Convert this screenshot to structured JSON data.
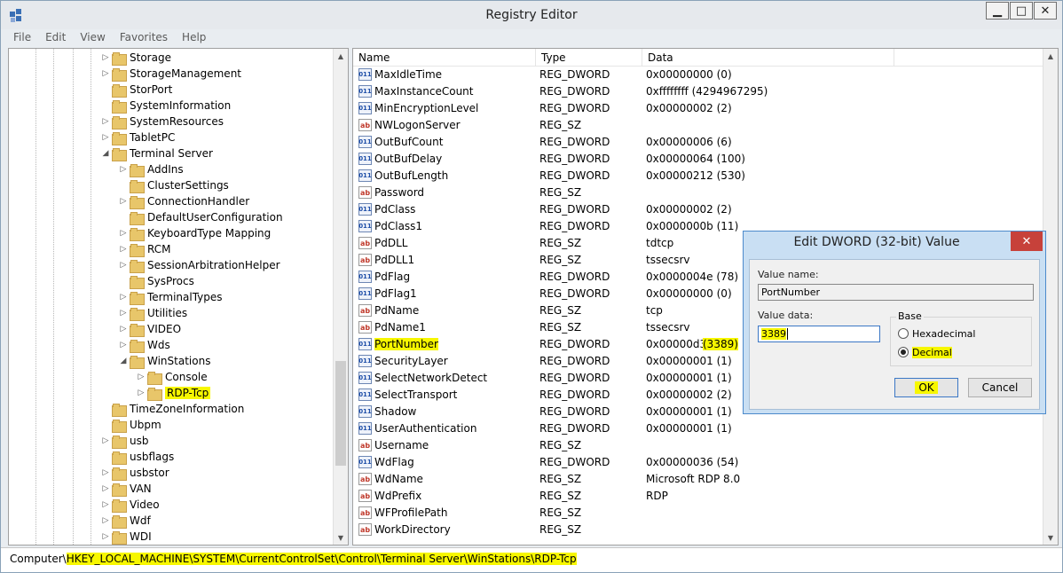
{
  "window": {
    "title": "Registry Editor"
  },
  "menu": [
    "File",
    "Edit",
    "View",
    "Favorites",
    "Help"
  ],
  "tree": [
    {
      "label": "Storage",
      "level": 0,
      "expand": "collapsed"
    },
    {
      "label": "StorageManagement",
      "level": 0,
      "expand": "collapsed"
    },
    {
      "label": "StorPort",
      "level": 0,
      "expand": "none"
    },
    {
      "label": "SystemInformation",
      "level": 0,
      "expand": "none"
    },
    {
      "label": "SystemResources",
      "level": 0,
      "expand": "collapsed"
    },
    {
      "label": "TabletPC",
      "level": 0,
      "expand": "collapsed"
    },
    {
      "label": "Terminal Server",
      "level": 0,
      "expand": "expanded"
    },
    {
      "label": "AddIns",
      "level": 1,
      "expand": "collapsed"
    },
    {
      "label": "ClusterSettings",
      "level": 1,
      "expand": "none"
    },
    {
      "label": "ConnectionHandler",
      "level": 1,
      "expand": "collapsed"
    },
    {
      "label": "DefaultUserConfiguration",
      "level": 1,
      "expand": "none"
    },
    {
      "label": "KeyboardType Mapping",
      "level": 1,
      "expand": "collapsed"
    },
    {
      "label": "RCM",
      "level": 1,
      "expand": "collapsed"
    },
    {
      "label": "SessionArbitrationHelper",
      "level": 1,
      "expand": "collapsed"
    },
    {
      "label": "SysProcs",
      "level": 1,
      "expand": "none"
    },
    {
      "label": "TerminalTypes",
      "level": 1,
      "expand": "collapsed"
    },
    {
      "label": "Utilities",
      "level": 1,
      "expand": "collapsed"
    },
    {
      "label": "VIDEO",
      "level": 1,
      "expand": "collapsed"
    },
    {
      "label": "Wds",
      "level": 1,
      "expand": "collapsed"
    },
    {
      "label": "WinStations",
      "level": 1,
      "expand": "expanded"
    },
    {
      "label": "Console",
      "level": 2,
      "expand": "collapsed"
    },
    {
      "label": "RDP-Tcp",
      "level": 2,
      "expand": "collapsed",
      "selected": true
    },
    {
      "label": "TimeZoneInformation",
      "level": 0,
      "expand": "none"
    },
    {
      "label": "Ubpm",
      "level": 0,
      "expand": "none"
    },
    {
      "label": "usb",
      "level": 0,
      "expand": "collapsed"
    },
    {
      "label": "usbflags",
      "level": 0,
      "expand": "none"
    },
    {
      "label": "usbstor",
      "level": 0,
      "expand": "collapsed"
    },
    {
      "label": "VAN",
      "level": 0,
      "expand": "collapsed"
    },
    {
      "label": "Video",
      "level": 0,
      "expand": "collapsed"
    },
    {
      "label": "Wdf",
      "level": 0,
      "expand": "collapsed"
    },
    {
      "label": "WDI",
      "level": 0,
      "expand": "collapsed"
    }
  ],
  "list": {
    "columns": [
      "Name",
      "Type",
      "Data"
    ],
    "rows": [
      {
        "name": "MaxIdleTime",
        "type": "REG_DWORD",
        "data": "0x00000000 (0)",
        "icon": "dword"
      },
      {
        "name": "MaxInstanceCount",
        "type": "REG_DWORD",
        "data": "0xffffffff (4294967295)",
        "icon": "dword"
      },
      {
        "name": "MinEncryptionLevel",
        "type": "REG_DWORD",
        "data": "0x00000002 (2)",
        "icon": "dword"
      },
      {
        "name": "NWLogonServer",
        "type": "REG_SZ",
        "data": "",
        "icon": "sz"
      },
      {
        "name": "OutBufCount",
        "type": "REG_DWORD",
        "data": "0x00000006 (6)",
        "icon": "dword"
      },
      {
        "name": "OutBufDelay",
        "type": "REG_DWORD",
        "data": "0x00000064 (100)",
        "icon": "dword"
      },
      {
        "name": "OutBufLength",
        "type": "REG_DWORD",
        "data": "0x00000212 (530)",
        "icon": "dword"
      },
      {
        "name": "Password",
        "type": "REG_SZ",
        "data": "",
        "icon": "sz"
      },
      {
        "name": "PdClass",
        "type": "REG_DWORD",
        "data": "0x00000002 (2)",
        "icon": "dword"
      },
      {
        "name": "PdClass1",
        "type": "REG_DWORD",
        "data": "0x0000000b (11)",
        "icon": "dword"
      },
      {
        "name": "PdDLL",
        "type": "REG_SZ",
        "data": "tdtcp",
        "icon": "sz"
      },
      {
        "name": "PdDLL1",
        "type": "REG_SZ",
        "data": "tssecsrv",
        "icon": "sz"
      },
      {
        "name": "PdFlag",
        "type": "REG_DWORD",
        "data": "0x0000004e (78)",
        "icon": "dword"
      },
      {
        "name": "PdFlag1",
        "type": "REG_DWORD",
        "data": "0x00000000 (0)",
        "icon": "dword"
      },
      {
        "name": "PdName",
        "type": "REG_SZ",
        "data": "tcp",
        "icon": "sz"
      },
      {
        "name": "PdName1",
        "type": "REG_SZ",
        "data": "tssecsrv",
        "icon": "sz"
      },
      {
        "name": "PortNumber",
        "type": "REG_DWORD",
        "data": "0x00000d3d",
        "data_extra": "(3389)",
        "icon": "dword",
        "highlight": true
      },
      {
        "name": "SecurityLayer",
        "type": "REG_DWORD",
        "data": "0x00000001 (1)",
        "icon": "dword"
      },
      {
        "name": "SelectNetworkDetect",
        "type": "REG_DWORD",
        "data": "0x00000001 (1)",
        "icon": "dword"
      },
      {
        "name": "SelectTransport",
        "type": "REG_DWORD",
        "data": "0x00000002 (2)",
        "icon": "dword"
      },
      {
        "name": "Shadow",
        "type": "REG_DWORD",
        "data": "0x00000001 (1)",
        "icon": "dword"
      },
      {
        "name": "UserAuthentication",
        "type": "REG_DWORD",
        "data": "0x00000001 (1)",
        "icon": "dword"
      },
      {
        "name": "Username",
        "type": "REG_SZ",
        "data": "",
        "icon": "sz"
      },
      {
        "name": "WdFlag",
        "type": "REG_DWORD",
        "data": "0x00000036 (54)",
        "icon": "dword"
      },
      {
        "name": "WdName",
        "type": "REG_SZ",
        "data": "Microsoft RDP 8.0",
        "icon": "sz"
      },
      {
        "name": "WdPrefix",
        "type": "REG_SZ",
        "data": "RDP",
        "icon": "sz"
      },
      {
        "name": "WFProfilePath",
        "type": "REG_SZ",
        "data": "",
        "icon": "sz"
      },
      {
        "name": "WorkDirectory",
        "type": "REG_SZ",
        "data": "",
        "icon": "sz"
      }
    ]
  },
  "status": {
    "prefix": "Computer\\",
    "path": "HKEY_LOCAL_MACHINE\\SYSTEM\\CurrentControlSet\\Control\\Terminal Server\\WinStations\\RDP-Tcp"
  },
  "dialog": {
    "title": "Edit DWORD (32-bit) Value",
    "close": "✕",
    "value_name_label": "Value name:",
    "value_name": "PortNumber",
    "value_data_label": "Value data:",
    "value_data": "3389",
    "base_label": "Base",
    "radio_hex": "Hexadecimal",
    "radio_dec": "Decimal",
    "ok": "OK",
    "cancel": "Cancel"
  },
  "colors": {
    "highlight": "#f7f700",
    "accent": "#4c8acb"
  }
}
